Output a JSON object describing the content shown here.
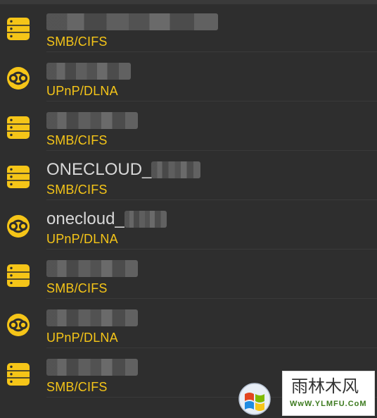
{
  "devices": [
    {
      "name": "",
      "protocol": "SMB/CIFS",
      "icon": "server-icon",
      "blur_width": 244
    },
    {
      "name": "",
      "protocol": "UPnP/DLNA",
      "icon": "dlna-icon",
      "blur_width": 120
    },
    {
      "name": "",
      "protocol": "SMB/CIFS",
      "icon": "server-icon",
      "blur_width": 130
    },
    {
      "name": "ONECLOUD_",
      "protocol": "SMB/CIFS",
      "icon": "server-icon",
      "blur_width": 70
    },
    {
      "name": "onecloud_",
      "protocol": "UPnP/DLNA",
      "icon": "dlna-icon",
      "blur_width": 60
    },
    {
      "name": "",
      "protocol": "SMB/CIFS",
      "icon": "server-icon",
      "blur_width": 130
    },
    {
      "name": "",
      "protocol": "UPnP/DLNA",
      "icon": "dlna-icon",
      "blur_width": 130
    },
    {
      "name": "",
      "protocol": "SMB/CIFS",
      "icon": "server-icon",
      "blur_width": 130
    }
  ],
  "colors": {
    "background": "#2e2e2e",
    "accent": "#f5c518",
    "name_text": "#d8d8d8"
  },
  "watermark": {
    "title": "雨林木风",
    "url": "WwW.YLMFU.CoM"
  }
}
